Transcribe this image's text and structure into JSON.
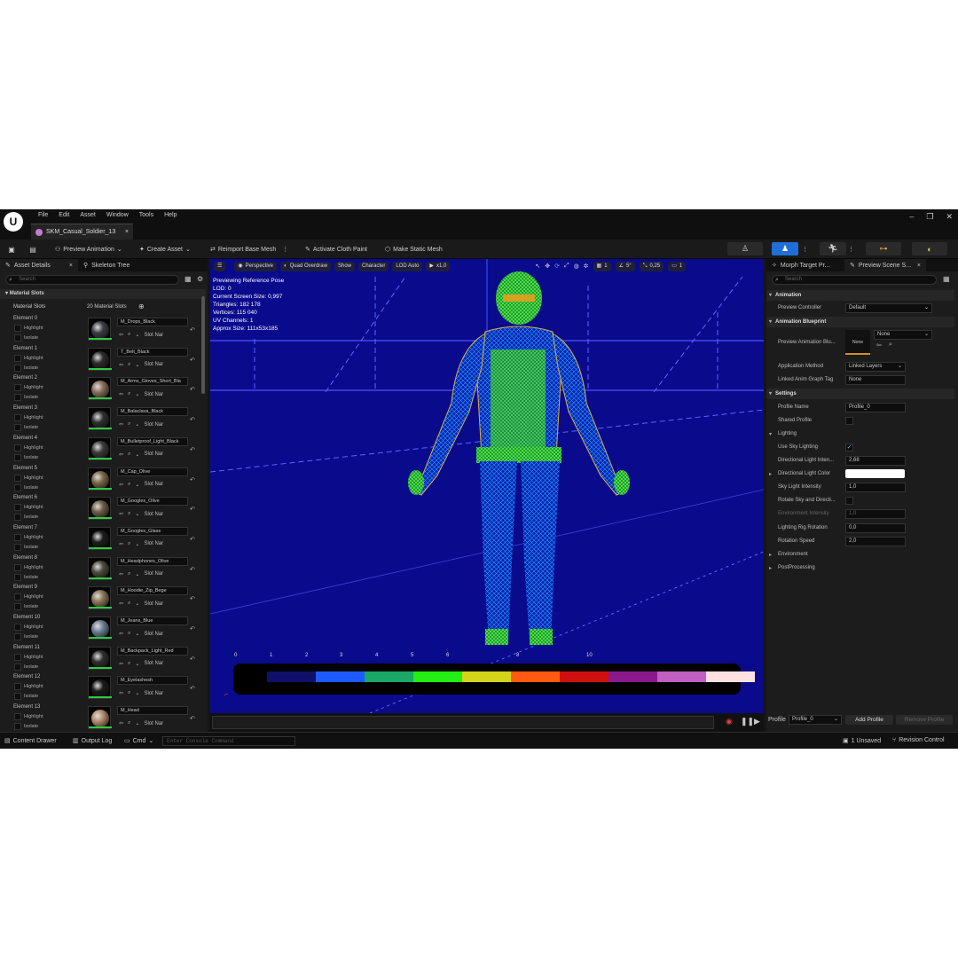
{
  "menu": {
    "logo": "U",
    "items": [
      "File",
      "Edit",
      "Asset",
      "Window",
      "Tools",
      "Help"
    ],
    "tab_title": "SKM_Casual_Soldier_13",
    "tab_close": "×",
    "win_min": "–",
    "win_max": "❐",
    "win_close": "✕"
  },
  "toolbar": {
    "preview_animation": "Preview Animation",
    "create_asset": "Create Asset",
    "reimport": "Reimport Base Mesh",
    "activate_cloth": "Activate Cloth Paint",
    "make_static": "Make Static Mesh"
  },
  "left": {
    "tab_asset_details": "Asset Details",
    "tab_skeleton_tree": "Skeleton Tree",
    "close": "×",
    "search_placeholder": "Search",
    "section": "Material Slots",
    "slots_label": "Material Slots",
    "slots_count": "20 Material Slots",
    "highlight": "Highlight",
    "isolate": "Isolate",
    "slot_name": "Slot Nar",
    "elements": [
      {
        "label": "Element 0",
        "material": "M_Drops_Black",
        "color": "#3a3d42"
      },
      {
        "label": "Element 1",
        "material": "T_Belt_Black",
        "color": "#2b2b2b"
      },
      {
        "label": "Element 2",
        "material": "M_Arms_Gloves_Short_Bla",
        "color": "#8a6d5a"
      },
      {
        "label": "Element 3",
        "material": "M_Balaclava_Black",
        "color": "#2f2f2f"
      },
      {
        "label": "Element 4",
        "material": "M_Bulletproof_Light_Black",
        "color": "#3a3a3a"
      },
      {
        "label": "Element 5",
        "material": "M_Cap_Olive",
        "color": "#7a6848"
      },
      {
        "label": "Element 6",
        "material": "M_Googles_Olive",
        "color": "#6b5d45"
      },
      {
        "label": "Element 7",
        "material": "M_Googles_Glass",
        "color": "#1c1c1c"
      },
      {
        "label": "Element 8",
        "material": "M_Headphones_Olive",
        "color": "#4d4a3c"
      },
      {
        "label": "Element 9",
        "material": "M_Hoodie_Zip_Bege",
        "color": "#8c7656"
      },
      {
        "label": "Element 10",
        "material": "M_Jeans_Blue",
        "color": "#6d7f96"
      },
      {
        "label": "Element 11",
        "material": "M_Backpack_Light_Red",
        "color": "#2e2e2e"
      },
      {
        "label": "Element 12",
        "material": "M_Eyelashesh",
        "color": "#1a1a1a"
      },
      {
        "label": "Element 13",
        "material": "M_Head",
        "color": "#b58a6e"
      }
    ]
  },
  "viewport": {
    "perspective": "Perspective",
    "quad_overdraw": "Quad Overdraw",
    "show": "Show",
    "character": "Character",
    "lod_auto": "LOD Auto",
    "play_speed": "x1,0",
    "grid_size": "1",
    "angle": "5°",
    "scale": "0,25",
    "cam": "1",
    "info": [
      "Previewing Reference Pose",
      "LOD: 0",
      "Current Screen Size: 0,997",
      "Triangles: 182 178",
      "Vertices: 115 040",
      "UV Channels: 1",
      "Approx Size: 111x53x185"
    ],
    "legend_numbers": [
      "0",
      "1",
      "2",
      "3",
      "4",
      "5",
      "6",
      "8",
      "10"
    ],
    "legend_colors": [
      "#10106a",
      "#1e5aff",
      "#1aa866",
      "#22ee11",
      "#d4d41a",
      "#ff5a10",
      "#d01010",
      "#8a1a8a",
      "#c060c0",
      "#ffe0e0"
    ],
    "legend_mark": " "
  },
  "right": {
    "tab_morph": "Morph Target Pr...",
    "tab_preview": "Preview Scene S...",
    "close": "×",
    "search_placeholder": "Search",
    "animation": "Animation",
    "preview_controller": "Preview Controller",
    "preview_controller_val": "Default",
    "anim_blueprint": "Animation Blueprint",
    "preview_anim_blu": "Preview Animation Blu...",
    "none": "None",
    "application_method": "Application Method",
    "application_method_val": "Linked Layers",
    "linked_anim_graph_tag": "Linked Anim Graph Tag",
    "settings": "Settings",
    "profile_name": "Profile Name",
    "profile_name_val": "Profile_0",
    "shared_profile": "Shared Profile",
    "lighting": "Lighting",
    "use_sky_lighting": "Use Sky Lighting",
    "dir_light_intensity": "Directional Light Inten...",
    "dir_light_intensity_val": "2,68",
    "dir_light_color": "Directional Light Color",
    "sky_light_intensity": "Sky Light Intensity",
    "sky_light_intensity_val": "1,0",
    "rotate_sky": "Rotate Sky and Directi...",
    "env_intensity": "Environment Intensity",
    "env_intensity_val": "1,0",
    "lighting_rig_rotation": "Lighting Rig Rotation",
    "lighting_rig_rotation_val": "0,0",
    "rotation_speed": "Rotation Speed",
    "rotation_speed_val": "2,0",
    "environment": "Environment",
    "postprocessing": "PostProcessing",
    "profile_label": "Profile",
    "profile_val": "Profile_0",
    "add_profile": "Add Profile",
    "remove_profile": "Remove Profile"
  },
  "status": {
    "content_drawer": "Content Drawer",
    "output_log": "Output Log",
    "cmd": "Cmd",
    "console_placeholder": "Enter Console Command",
    "unsaved": "1 Unsaved",
    "revision_control": "Revision Control"
  }
}
